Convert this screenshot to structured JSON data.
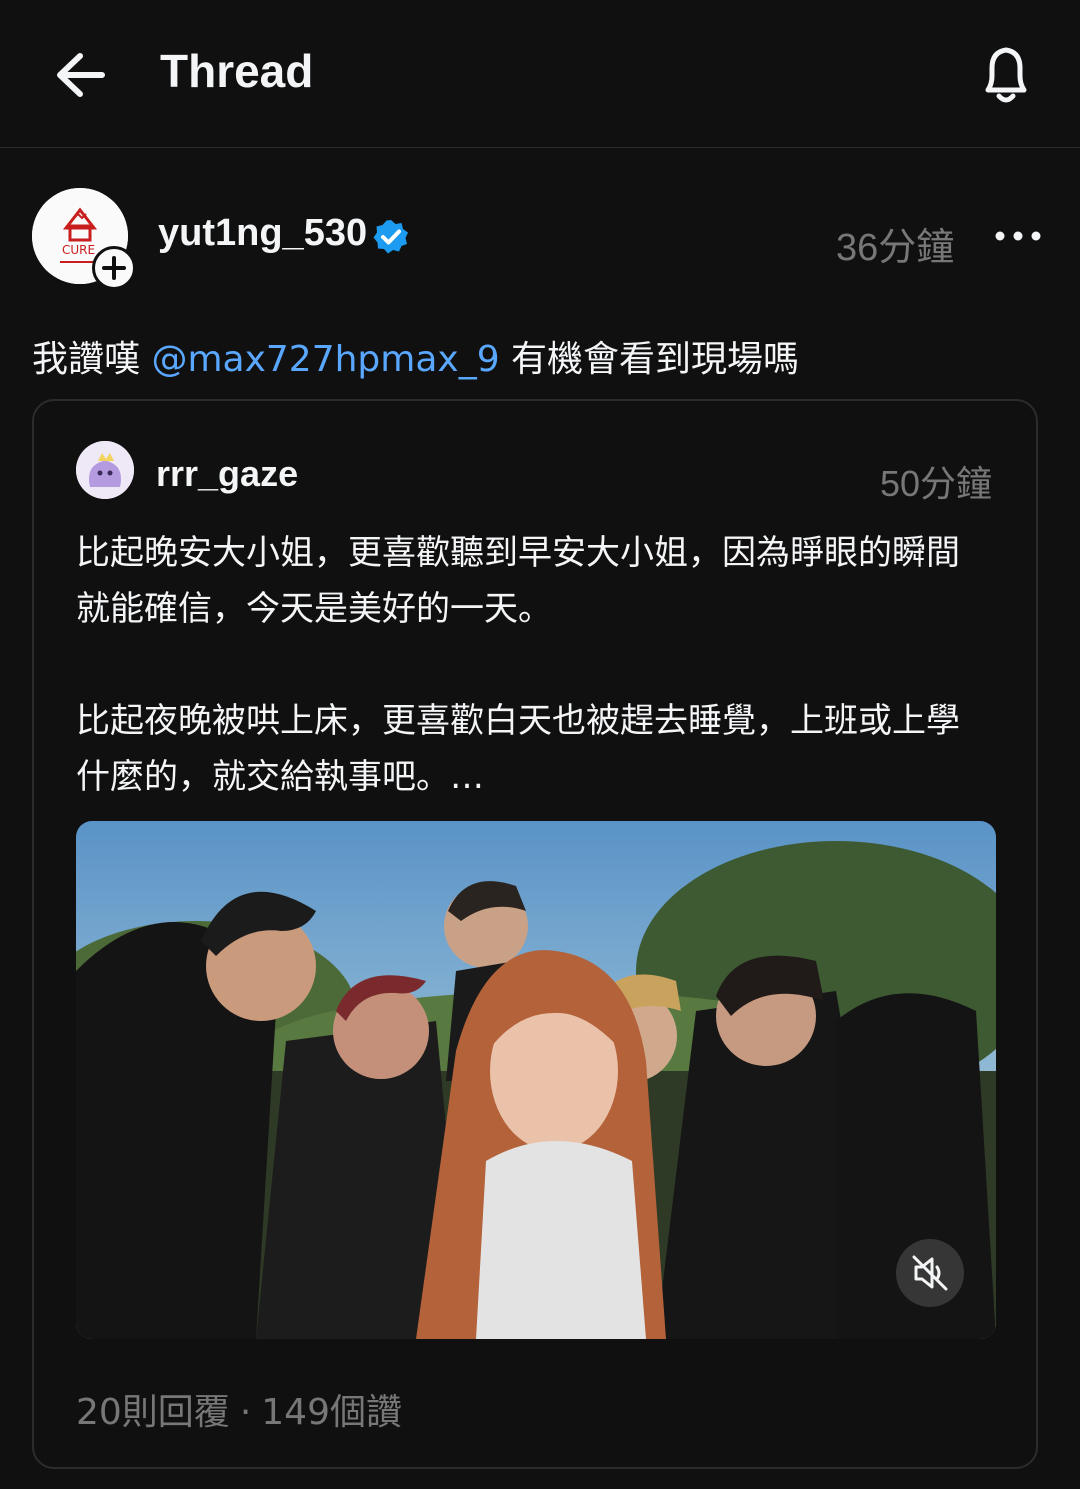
{
  "header": {
    "title": "Thread",
    "back_icon": "arrow-left-icon",
    "notify_icon": "bell-icon"
  },
  "post": {
    "author": "yut1ng_530",
    "verified": true,
    "time": "36分鐘",
    "text_prefix": "我讚嘆 ",
    "mention": "@max727hpmax_9",
    "text_suffix": " 有機會看到現場嗎",
    "avatar_logo_text": "CURE"
  },
  "quote": {
    "author": "rrr_gaze",
    "time": "50分鐘",
    "text": "比起晚安大小姐，更喜歡聽到早安大小姐，因為睜眼的瞬間就能確信，今天是美好的一天。\n\n比起夜晚被哄上床，更喜歡白天也被趕去睡覺，上班或上學什麼的，就交給執事吧。…",
    "replies": "20則回覆",
    "separator": "·",
    "likes": "149個讚"
  },
  "colors": {
    "background": "#101010",
    "text": "#f3f5f7",
    "muted": "#777777",
    "mention": "#5aa7ff",
    "verified": "#1d9bf0",
    "border": "#2c2c2c"
  }
}
